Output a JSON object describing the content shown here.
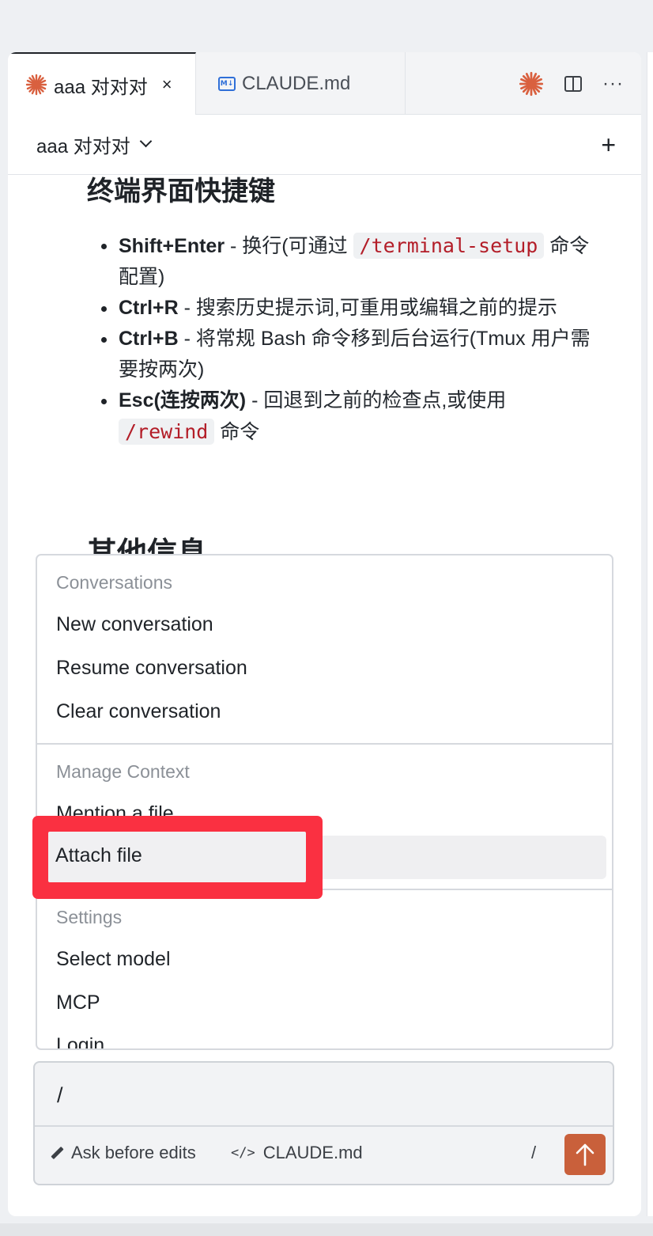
{
  "colors": {
    "accent": "#d9603f",
    "send_button": "#c9603b",
    "highlight_border": "#fa3041",
    "code_text": "#b31d28"
  },
  "tabs": [
    {
      "label": "aaa 对对对",
      "icon": "claude-asterisk-icon",
      "active": true,
      "close": "×"
    },
    {
      "label": "CLAUDE.md",
      "icon": "markdown-file-icon",
      "active": false
    }
  ],
  "tab_actions": {
    "more": "···"
  },
  "header": {
    "title": "aaa 对对对",
    "new_label": "+"
  },
  "content": {
    "partial_heading": "终端界面快捷键",
    "shortcuts": [
      {
        "key": "Shift+Enter",
        "text_before": " - 换行(可通过 ",
        "code": "/terminal-setup",
        "text_after": " 命令配置)"
      },
      {
        "key": "Ctrl+R",
        "text_before": " - 搜索历史提示词,可重用或编辑之前的提示"
      },
      {
        "key": "Ctrl+B",
        "text_before": " - 将常规 Bash 命令移到后台运行(Tmux 用户需要按两次)"
      },
      {
        "key": "Esc(连按两次)",
        "text_before": " - 回退到之前的检查点,或使用 ",
        "code": "/rewind",
        "text_after": " 命令"
      }
    ],
    "heading_other": "其他信息"
  },
  "menu": {
    "conversations_label": "Conversations",
    "new_conversation": "New conversation",
    "resume_conversation": "Resume conversation",
    "clear_conversation": "Clear conversation",
    "manage_context_label": "Manage Context",
    "mention_file": "Mention a file",
    "attach_file": "Attach file",
    "settings_label": "Settings",
    "select_model": "Select model",
    "mcp": "MCP",
    "login": "Login"
  },
  "input": {
    "value": "/",
    "mode_label": "Ask before edits",
    "file_label": "CLAUDE.md",
    "slash_hint": "/"
  }
}
